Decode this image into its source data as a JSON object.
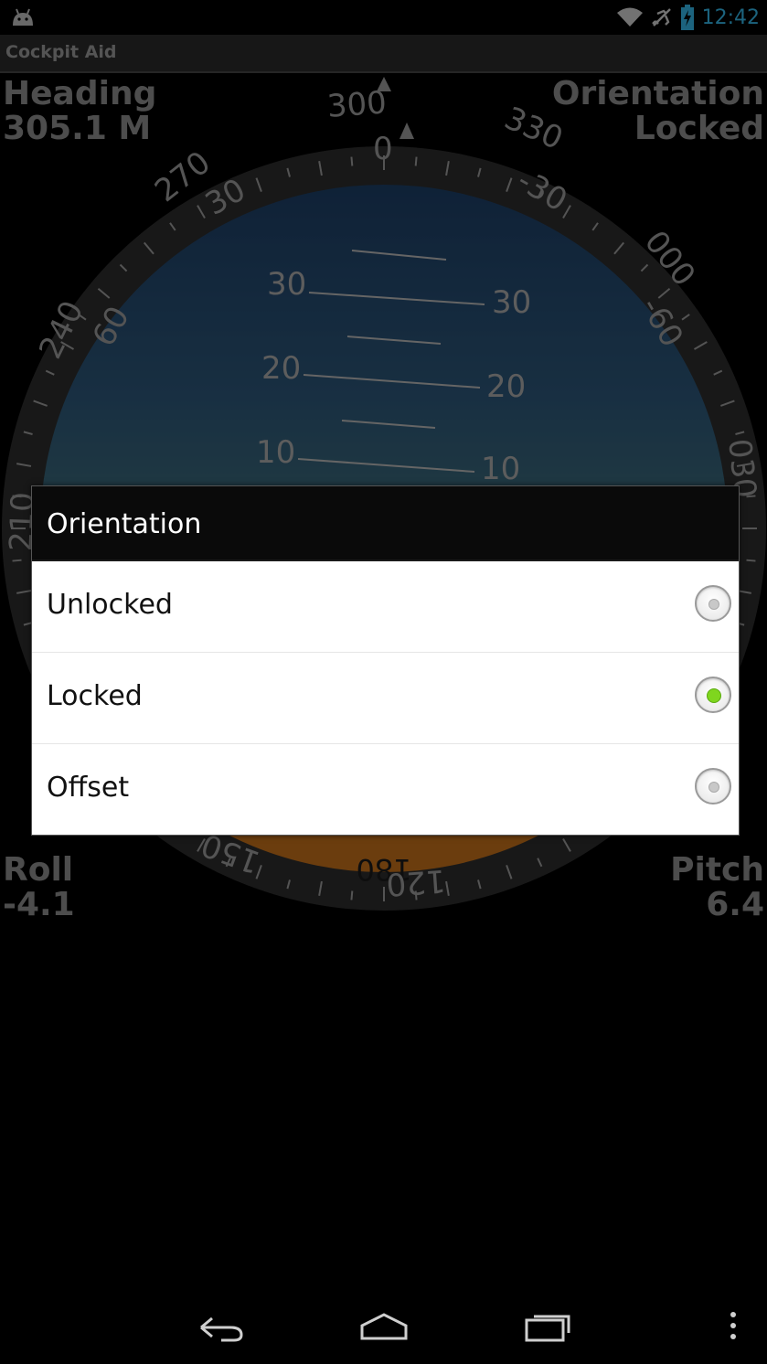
{
  "status_bar": {
    "time": "12:42",
    "icons": [
      "android-icon",
      "wifi-icon",
      "airplane-icon",
      "battery-charging-icon"
    ],
    "accent_color": "#33b5e5"
  },
  "app": {
    "title": "Cockpit Aid"
  },
  "instruments": {
    "heading_label": "Heading",
    "heading_value": "305.1 M",
    "orientation_label": "Orientation",
    "orientation_value": "Locked",
    "roll_label": "Roll",
    "roll_value": "-4.1",
    "pitch_label": "Pitch",
    "pitch_value": "6.4"
  },
  "attitude_indicator": {
    "compass_labels": [
      "300",
      "330",
      "000",
      "030",
      "120",
      "150",
      "240",
      "270",
      "210"
    ],
    "bank_labels": [
      "0",
      "30",
      "-30",
      "60",
      "-60"
    ],
    "pitch_labels_left": [
      "30",
      "20",
      "10"
    ],
    "pitch_labels_right": [
      "30",
      "20",
      "10"
    ],
    "ground_labels": [
      "180"
    ],
    "sky_color": "#1c3f6e",
    "ground_color": "#c4701a"
  },
  "dialog": {
    "title": "Orientation",
    "options": [
      {
        "label": "Unlocked",
        "selected": false
      },
      {
        "label": "Locked",
        "selected": true
      },
      {
        "label": "Offset",
        "selected": false
      }
    ],
    "selected_color": "#7fd61e"
  },
  "nav_bar": {
    "buttons": [
      "back-icon",
      "home-icon",
      "recent-apps-icon",
      "overflow-menu-icon"
    ]
  }
}
